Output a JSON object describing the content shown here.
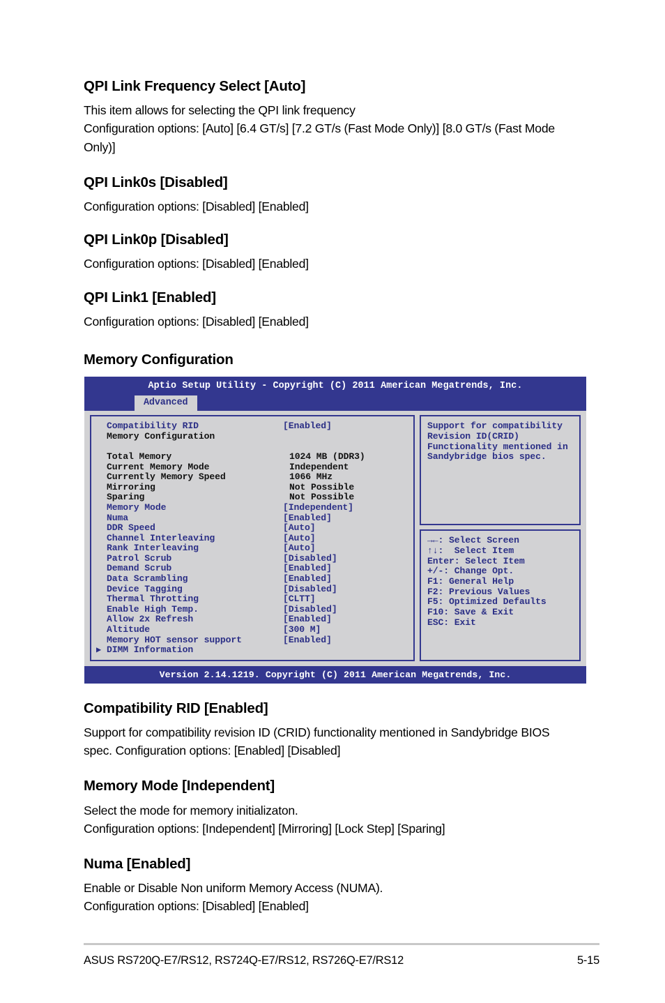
{
  "document": {
    "sections": [
      {
        "heading": "QPI Link Frequency Select [Auto]",
        "lines": [
          "This item allows for selecting the QPI link frequency",
          "Configuration options: [Auto] [6.4 GT/s] [7.2 GT/s (Fast Mode Only)] [8.0 GT/s (Fast Mode Only)]"
        ]
      },
      {
        "heading": "QPI Link0s [Disabled]",
        "lines": [
          "Configuration options: [Disabled] [Enabled]"
        ]
      },
      {
        "heading": "QPI Link0p [Disabled]",
        "lines": [
          "Configuration options: [Disabled] [Enabled]"
        ]
      },
      {
        "heading": "QPI Link1 [Enabled]",
        "lines": [
          "Configuration options: [Disabled] [Enabled]"
        ]
      }
    ],
    "memory_config_heading": "Memory Configuration",
    "lower_sections": [
      {
        "heading": "Compatibility RID [Enabled]",
        "lines": [
          "Support for compatibility revision ID (CRID) functionality mentioned in Sandybridge BIOS spec. Configuration options: [Enabled] [Disabled]"
        ]
      },
      {
        "heading": "Memory Mode [Independent]",
        "lines": [
          "Select the mode for memory initializaton.",
          "Configuration options: [Independent] [Mirroring] [Lock Step] [Sparing]"
        ]
      },
      {
        "heading": "Numa [Enabled]",
        "lines": [
          "Enable or Disable Non uniform Memory Access (NUMA).",
          "Configuration options: [Disabled] [Enabled]"
        ]
      }
    ]
  },
  "bios": {
    "title": "Aptio Setup Utility - Copyright (C) 2011 American Megatrends, Inc.",
    "tab": "Advanced",
    "rows": [
      {
        "type": "setting",
        "label": "Compatibility RID",
        "value": "[Enabled]"
      },
      {
        "type": "heading",
        "label": "Memory Configuration",
        "value": ""
      },
      {
        "type": "spacer",
        "label": "",
        "value": ""
      },
      {
        "type": "info",
        "label": "Total Memory",
        "value": "1024 MB (DDR3)"
      },
      {
        "type": "info",
        "label": "Current Memory Mode",
        "value": "Independent"
      },
      {
        "type": "info",
        "label": "Currently Memory Speed",
        "value": "1066 MHz"
      },
      {
        "type": "info",
        "label": "Mirroring",
        "value": "Not Possible"
      },
      {
        "type": "info",
        "label": "Sparing",
        "value": "Not Possible"
      },
      {
        "type": "setting",
        "label": "Memory Mode",
        "value": "[Independent]"
      },
      {
        "type": "setting",
        "label": "Numa",
        "value": "[Enabled]"
      },
      {
        "type": "setting",
        "label": "DDR Speed",
        "value": "[Auto]"
      },
      {
        "type": "setting",
        "label": "Channel Interleaving",
        "value": "[Auto]"
      },
      {
        "type": "setting",
        "label": "Rank Interleaving",
        "value": "[Auto]"
      },
      {
        "type": "setting",
        "label": "Patrol Scrub",
        "value": "[Disabled]"
      },
      {
        "type": "setting",
        "label": "Demand Scrub",
        "value": "[Enabled]"
      },
      {
        "type": "setting",
        "label": "Data Scrambling",
        "value": "[Enabled]"
      },
      {
        "type": "setting",
        "label": "Device Tagging",
        "value": "[Disabled]"
      },
      {
        "type": "setting",
        "label": "Thermal Throtting",
        "value": "[CLTT]"
      },
      {
        "type": "setting",
        "label": "Enable High Temp.",
        "value": "[Disabled]"
      },
      {
        "type": "setting",
        "label": "Allow 2x Refresh",
        "value": "[Enabled]"
      },
      {
        "type": "setting",
        "label": "Altitude",
        "value": "[300 M]"
      },
      {
        "type": "setting",
        "label": "Memory HOT sensor support",
        "value": "[Enabled]"
      },
      {
        "type": "submenu",
        "label": "DIMM Information",
        "value": ""
      }
    ],
    "help_lines": [
      "Support for compatibility",
      "Revision ID(CRID)",
      "Functionality mentioned in",
      "Sandybridge bios spec."
    ],
    "key_lines": [
      "→←: Select Screen",
      "↑↓:  Select Item",
      "Enter: Select Item",
      "+/-: Change Opt.",
      "F1: General Help",
      "F2: Previous Values",
      "F5: Optimized Defaults",
      "F10: Save & Exit",
      "ESC: Exit"
    ],
    "footer": "Version 2.14.1219. Copyright (C) 2011 American Megatrends, Inc."
  },
  "page_footer": {
    "models": "ASUS RS720Q-E7/RS12, RS724Q-E7/RS12, RS726Q-E7/RS12",
    "page_number": "5-15"
  },
  "colors": {
    "bios_chrome": "#33378f",
    "bios_panel": "#d2d2d4",
    "bios_setting_text": "#2b2f86"
  }
}
